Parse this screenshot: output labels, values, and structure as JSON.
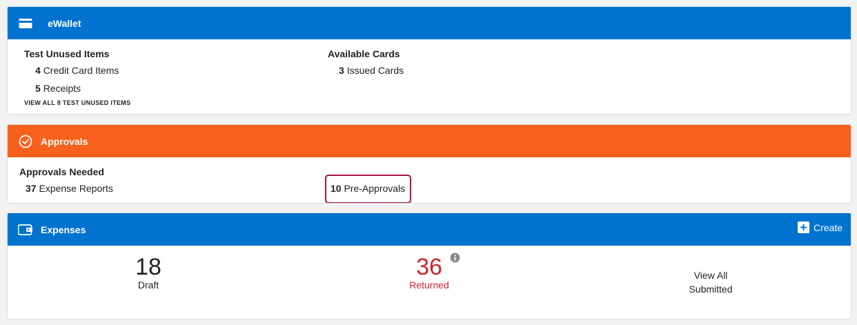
{
  "ewallet": {
    "title": "eWallet",
    "left_heading": "Test Unused Items",
    "items": [
      {
        "count": "4",
        "label": "Credit Card Items"
      },
      {
        "count": "5",
        "label": "Receipts"
      }
    ],
    "view_all_link": "VIEW ALL 8 TEST UNUSED ITEMS",
    "right_heading": "Available Cards",
    "cards": {
      "count": "3",
      "label": "Issued Cards"
    }
  },
  "approvals": {
    "title": "Approvals",
    "heading": "Approvals Needed",
    "expense_reports": {
      "count": "37",
      "label": "Expense Reports"
    },
    "pre_approvals": {
      "count": "10",
      "label": "Pre-Approvals"
    }
  },
  "expenses": {
    "title": "Expenses",
    "create_label": "Create",
    "draft": {
      "count": "18",
      "label": "Draft"
    },
    "returned": {
      "count": "36",
      "label": "Returned"
    },
    "view_all_line1": "View All",
    "view_all_line2": "Submitted"
  },
  "colors": {
    "blue_header": "#0073cf",
    "orange_header": "#f7611e",
    "returned_red": "#d0262a",
    "highlight": "#a3144a"
  }
}
